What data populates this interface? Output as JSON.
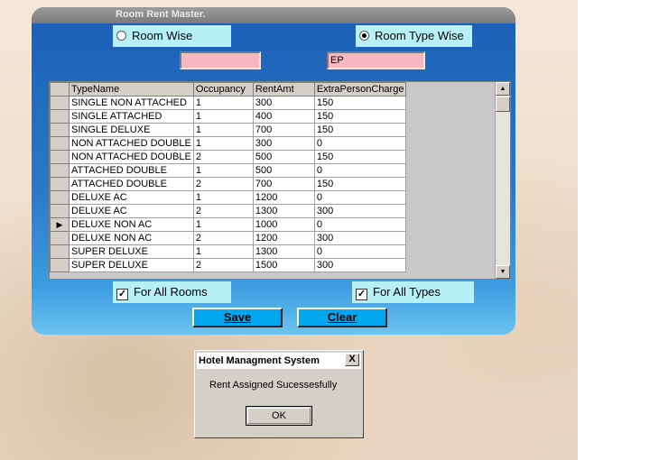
{
  "window": {
    "title": "Room Rent Master."
  },
  "options": {
    "room_wise": "Room Wise",
    "room_type_wise": "Room Type Wise",
    "selected": "room_type_wise"
  },
  "inputs": {
    "room_value": "",
    "type_value": "EP"
  },
  "grid": {
    "columns": [
      "TypeName",
      "Occupancy",
      "RentAmt",
      "ExtraPersonCharge"
    ],
    "rows": [
      [
        "SINGLE NON ATTACHED",
        "1",
        "300",
        "150"
      ],
      [
        "SINGLE ATTACHED",
        "1",
        "400",
        "150"
      ],
      [
        "SINGLE DELUXE",
        "1",
        "700",
        "150"
      ],
      [
        "NON ATTACHED DOUBLE",
        "1",
        "300",
        "0"
      ],
      [
        "NON ATTACHED DOUBLE",
        "2",
        "500",
        "150"
      ],
      [
        "ATTACHED DOUBLE",
        "1",
        "500",
        "0"
      ],
      [
        "ATTACHED DOUBLE",
        "2",
        "700",
        "150"
      ],
      [
        "DELUXE AC",
        "1",
        "1200",
        "0"
      ],
      [
        "DELUXE AC",
        "2",
        "1300",
        "300"
      ],
      [
        "DELUXE NON AC",
        "1",
        "1000",
        "0"
      ],
      [
        "DELUXE NON AC",
        "2",
        "1200",
        "300"
      ],
      [
        "SUPER DELUXE",
        "1",
        "1300",
        "0"
      ],
      [
        "SUPER DELUXE",
        "2",
        "1500",
        "300"
      ]
    ],
    "current_row": 9
  },
  "checkboxes": {
    "all_rooms": "For All Rooms",
    "all_types": "For All Types",
    "all_rooms_checked": true,
    "all_types_checked": true
  },
  "buttons": {
    "save": "Save",
    "clear": "Clear"
  },
  "dialog": {
    "title": "Hotel Managment System",
    "message": "Rent Assigned Sucessesfully",
    "ok": "OK",
    "close_glyph": "X"
  },
  "icons": {
    "row_pointer": "current-row-pointer-icon",
    "scroll_up": "scroll-up-arrow-icon",
    "scroll_down": "scroll-down-arrow-icon",
    "check": "checkmark-icon"
  }
}
